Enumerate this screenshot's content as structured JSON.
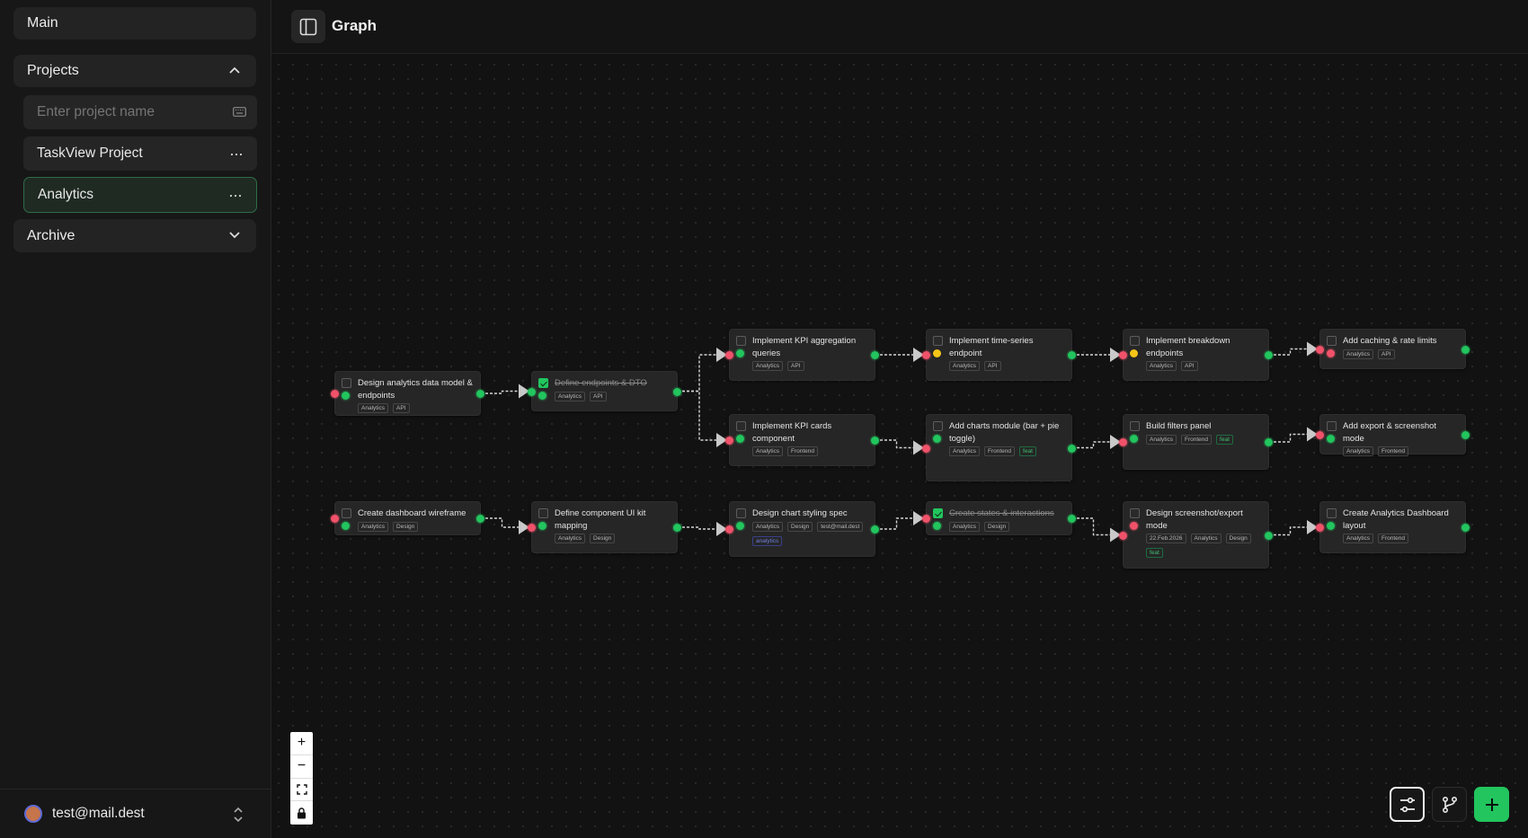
{
  "sidebar": {
    "main_label": "Main",
    "projects_label": "Projects",
    "project_input_placeholder": "Enter project name",
    "projects": [
      {
        "name": "TaskView Project",
        "menu": "···"
      },
      {
        "name": "Analytics",
        "menu": "···",
        "selected": true
      }
    ],
    "archive_label": "Archive",
    "user_email": "test@mail.dest"
  },
  "header": {
    "title": "Graph"
  },
  "colors": {
    "accent": "#22c55e",
    "danger": "#f0526a",
    "warning": "#f5c518",
    "node_bg": "#262626",
    "canvas_bg": "#121212"
  },
  "graph": {
    "nodes": [
      {
        "title": "Design analytics data model & endpoints",
        "done": false,
        "tags": [
          "Analytics",
          "API"
        ]
      },
      {
        "title": "Define endpoints & DTO",
        "done": true,
        "tags": [
          "Analytics",
          "API"
        ]
      },
      {
        "title": "Implement KPI aggregation queries",
        "done": false,
        "tags": [
          "Analytics",
          "API"
        ]
      },
      {
        "title": "Implement time-series endpoint",
        "done": false,
        "tags": [
          "Analytics",
          "API"
        ]
      },
      {
        "title": "Implement breakdown endpoints",
        "done": false,
        "tags": [
          "Analytics",
          "API"
        ]
      },
      {
        "title": "Add caching & rate limits",
        "done": false,
        "tags": [
          "Analytics",
          "API"
        ]
      },
      {
        "title": "Implement KPI cards component",
        "done": false,
        "tags": [
          "Analytics",
          "Frontend"
        ]
      },
      {
        "title": "Add charts module (bar + pie toggle)",
        "done": false,
        "tags": [
          "Analytics",
          "Frontend",
          "feat"
        ]
      },
      {
        "title": "Build filters panel",
        "done": false,
        "tags": [
          "Analytics",
          "Frontend",
          "feat"
        ]
      },
      {
        "title": "Add export & screenshot mode",
        "done": false,
        "tags": [
          "Analytics",
          "Frontend"
        ]
      },
      {
        "title": "Create dashboard wireframe",
        "done": false,
        "tags": [
          "Analytics",
          "Design"
        ]
      },
      {
        "title": "Define component UI kit mapping",
        "done": false,
        "tags": [
          "Analytics",
          "Design"
        ]
      },
      {
        "title": "Design chart styling spec",
        "done": false,
        "tags": [
          "Analytics",
          "Design",
          "test@mail.dest",
          "analytics"
        ]
      },
      {
        "title": "Create states & interactions",
        "done": true,
        "tags": [
          "Analytics",
          "Design"
        ]
      },
      {
        "title": "Design screenshot/export mode",
        "done": false,
        "tags": [
          "22.Feb.2026",
          "Analytics",
          "Design",
          "feat"
        ]
      },
      {
        "title": "Create Analytics Dashboard layout",
        "done": false,
        "tags": [
          "Analytics",
          "Frontend"
        ]
      }
    ]
  },
  "zoom_controls": [
    "+",
    "−",
    "⛶",
    "🔒"
  ],
  "fab_icons": [
    "filters-icon",
    "git-branch-icon",
    "plus-icon"
  ]
}
